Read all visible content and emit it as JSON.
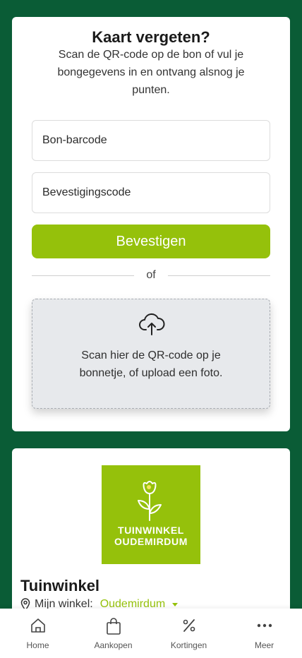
{
  "card": {
    "title": "Kaart vergeten?",
    "description": "Scan de QR-code op de bon of vul je bongegevens in en ontvang alsnog je punten.",
    "barcode_placeholder": "Bon-barcode",
    "code_placeholder": "Bevestigingscode",
    "confirm_label": "Bevestigen",
    "divider_text": "of",
    "upload_text": "Scan hier de QR-code op je bonnetje, of upload een foto."
  },
  "store": {
    "logo_line1": "TUINWINKEL",
    "logo_line2": "OUDEMIRDUM",
    "name": "Tuinwinkel",
    "my_store_label": "Mijn winkel:",
    "my_store_value": "Oudemirdum"
  },
  "nav": {
    "home": "Home",
    "purchases": "Aankopen",
    "discounts": "Kortingen",
    "more": "Meer"
  },
  "colors": {
    "background": "#0a5c36",
    "accent": "#95c10b"
  }
}
